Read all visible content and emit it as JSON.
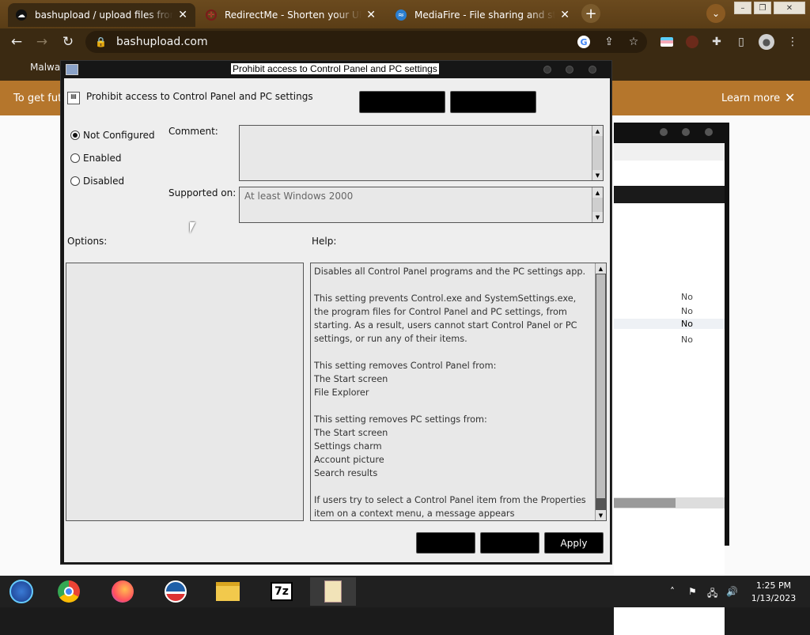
{
  "browser": {
    "tabs": [
      {
        "label": "bashupload / upload files from co",
        "icon": "cloud-icon",
        "active": true
      },
      {
        "label": "RedirectMe - Shorten your URL",
        "icon": "crosshair-icon",
        "active": false
      },
      {
        "label": "MediaFire - File sharing and stor",
        "icon": "mediafire-icon",
        "active": false
      }
    ],
    "url": "bashupload.com",
    "bookmark": "Malwar",
    "banner_text": "To get fut",
    "banner_link": "Learn more"
  },
  "back_window": {
    "values": [
      "No",
      "No",
      "No",
      "No"
    ]
  },
  "dialog": {
    "window_title": "Prohibit access to Control Panel and PC settings",
    "setting_title": "Prohibit access to Control Panel and PC settings",
    "radios": [
      {
        "label": "Not Configured",
        "selected": true
      },
      {
        "label": "Enabled",
        "selected": false
      },
      {
        "label": "Disabled",
        "selected": false
      }
    ],
    "comment_label": "Comment:",
    "comment_value": "",
    "supported_label": "Supported on:",
    "supported_value": "At least Windows 2000",
    "options_label": "Options:",
    "help_label": "Help:",
    "help_text": "Disables all Control Panel programs and the PC settings app.\n\nThis setting prevents Control.exe and SystemSettings.exe, the program files for Control Panel and PC settings, from starting. As a result, users cannot start Control Panel or PC settings, or run any of their items.\n\nThis setting removes Control Panel from:\nThe Start screen\nFile Explorer\n\nThis setting removes PC settings from:\nThe Start screen\nSettings charm\nAccount picture\nSearch results\n\nIf users try to select a Control Panel item from the Properties item on a context menu, a message appears",
    "apply_label": "Apply"
  },
  "taskbar": {
    "apps": [
      "start-icon",
      "chrome-icon",
      "firefox-icon",
      "obama-icon",
      "file-explorer-icon",
      "7zip-icon",
      "notepad-icon"
    ],
    "time": "1:25 PM",
    "date": "1/13/2023"
  }
}
